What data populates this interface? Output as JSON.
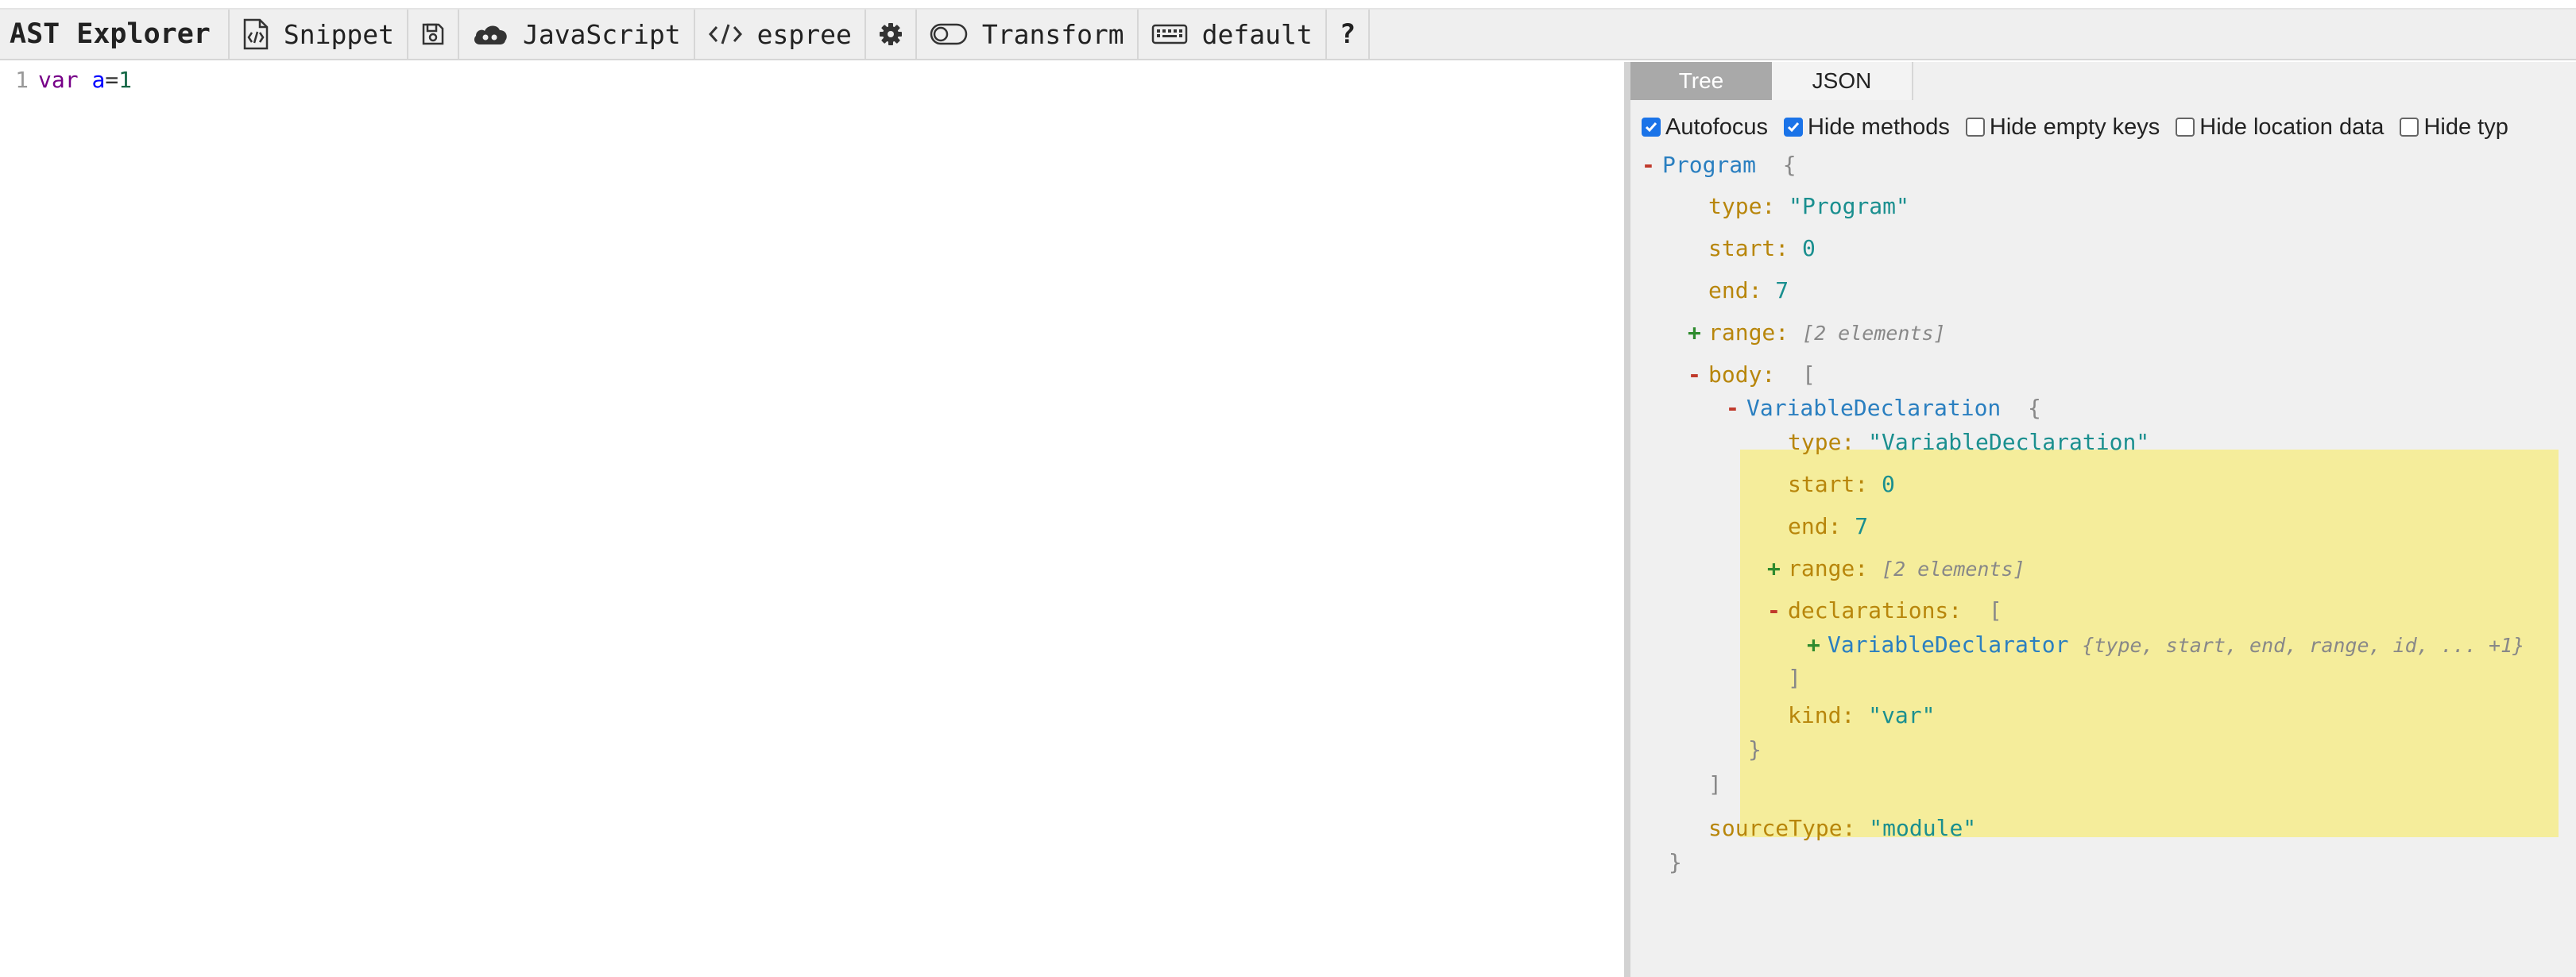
{
  "toolbar": {
    "title": "AST Explorer",
    "snippet_label": "Snippet",
    "language_label": "JavaScript",
    "parser_label": "espree",
    "transform_label": "Transform",
    "keymap_label": "default",
    "help_label": "?"
  },
  "editor": {
    "line_number": "1",
    "code": {
      "keyword": "var",
      "identifier": "a",
      "operator": "=",
      "value": "1"
    }
  },
  "output": {
    "tabs": [
      {
        "label": "Tree"
      },
      {
        "label": "JSON"
      }
    ],
    "active_tab": "Tree",
    "options": [
      {
        "label": "Autofocus",
        "checked": true
      },
      {
        "label": "Hide methods",
        "checked": true
      },
      {
        "label": "Hide empty keys",
        "checked": false
      },
      {
        "label": "Hide location data",
        "checked": false
      },
      {
        "label": "Hide typ",
        "checked": false
      }
    ],
    "tree": {
      "program": {
        "toggle": "-",
        "name": "Program",
        "open": "{",
        "close": "}"
      },
      "type": {
        "key": "type:",
        "value": "\"Program\""
      },
      "start": {
        "key": "start:",
        "value": "0"
      },
      "end": {
        "key": "end:",
        "value": "7"
      },
      "range": {
        "toggle": "+",
        "key": "range:",
        "placeholder": "[2 elements]"
      },
      "body": {
        "toggle": "-",
        "key": "body:",
        "open": "[",
        "close": "]"
      },
      "decl": {
        "toggle": "-",
        "name": "VariableDeclaration",
        "open": "{",
        "close": "}"
      },
      "decl_type": {
        "key": "type:",
        "value": "\"VariableDeclaration\""
      },
      "decl_start": {
        "key": "start:",
        "value": "0"
      },
      "decl_end": {
        "key": "end:",
        "value": "7"
      },
      "decl_range": {
        "toggle": "+",
        "key": "range:",
        "placeholder": "[2 elements]"
      },
      "declarations": {
        "toggle": "-",
        "key": "declarations:",
        "open": "[",
        "close": "]"
      },
      "declarator": {
        "toggle": "+",
        "name": "VariableDeclarator",
        "summary": "{type, start, end, range, id, ... +1}"
      },
      "kind": {
        "key": "kind:",
        "value": "\"var\""
      },
      "sourceType": {
        "key": "sourceType:",
        "value": "\"module\""
      }
    }
  },
  "colors": {
    "toolbar_bg": "#efefef",
    "highlight": "#f5ed9b",
    "node_name": "#2a7fc0",
    "key": "#b8860b",
    "string": "#1a8f8f",
    "collapse": "#c0392b",
    "expand": "#2e8b2e"
  }
}
